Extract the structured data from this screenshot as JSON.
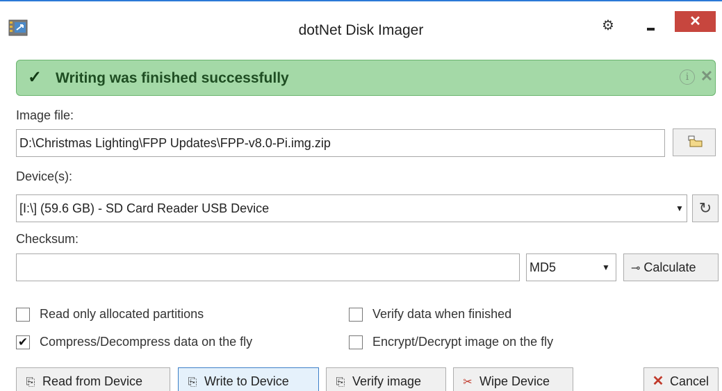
{
  "window": {
    "title": "dotNet Disk Imager",
    "close_glyph": "✕",
    "settings_glyph": "⚙"
  },
  "notification": {
    "message": "Writing was finished successfully",
    "check_glyph": "✓",
    "info_glyph": "i",
    "dismiss_glyph": "✕",
    "color": "#a4d9a7"
  },
  "image_file": {
    "label": "Image file:",
    "value": "D:\\Christmas Lighting\\FPP Updates\\FPP-v8.0-Pi.img.zip"
  },
  "device": {
    "label": "Device(s):",
    "value": "[I:\\] (59.6 GB) - SD Card Reader USB Device",
    "refresh_glyph": "↻"
  },
  "checksum": {
    "label": "Checksum:",
    "value": "",
    "algorithm": "MD5",
    "calculate_label": "Calculate",
    "key_glyph": "⊸"
  },
  "options": {
    "read_only_allocated": {
      "label": "Read only allocated partitions",
      "checked": false
    },
    "verify_when_finished": {
      "label": "Verify data when finished",
      "checked": false
    },
    "compress_on_fly": {
      "label": "Compress/Decompress data on the fly",
      "checked": true,
      "mark": "✔"
    },
    "encrypt_on_fly": {
      "label": "Encrypt/Decrypt image on the fly",
      "checked": false
    }
  },
  "actions": {
    "read_label": "Read from Device",
    "write_label": "Write to Device",
    "verify_label": "Verify image",
    "wipe_label": "Wipe Device",
    "cancel_label": "Cancel",
    "cancel_glyph": "✕"
  },
  "colors": {
    "accent": "#2b79d7",
    "close_button": "#c7463e",
    "cancel_icon": "#c0392b"
  }
}
